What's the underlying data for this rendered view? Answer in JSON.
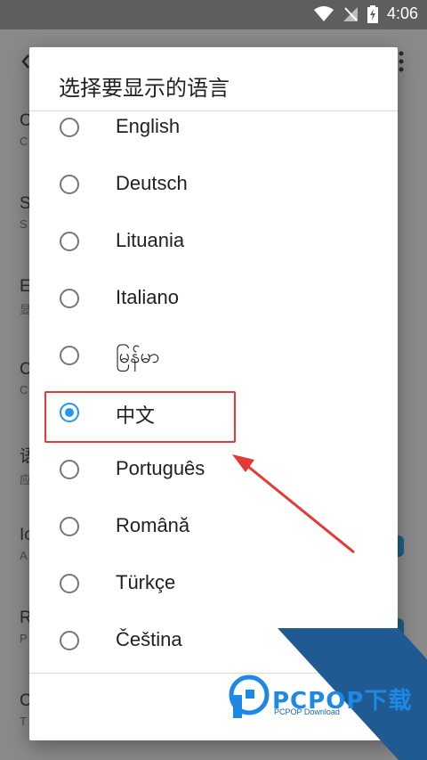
{
  "status": {
    "time": "4:06"
  },
  "background": {
    "rows": [
      {
        "title": "C",
        "subtitle": "C"
      },
      {
        "title": "S",
        "subtitle": "S"
      },
      {
        "title": "E",
        "subtitle": "显"
      },
      {
        "title": "C",
        "subtitle": "C"
      },
      {
        "title": "语",
        "subtitle": "应"
      },
      {
        "title": "Ic",
        "subtitle": "A"
      },
      {
        "title": "R",
        "subtitle": "P"
      },
      {
        "title": "C",
        "subtitle": "T"
      }
    ]
  },
  "dialog": {
    "title": "选择要显示的语言",
    "options": [
      {
        "label": "English",
        "checked": false
      },
      {
        "label": "Deutsch",
        "checked": false
      },
      {
        "label": "Lituania",
        "checked": false
      },
      {
        "label": "Italiano",
        "checked": false
      },
      {
        "label": "မြန်မာ",
        "checked": false
      },
      {
        "label": "中文",
        "checked": true
      },
      {
        "label": "Português",
        "checked": false
      },
      {
        "label": "Română",
        "checked": false
      },
      {
        "label": "Türkçe",
        "checked": false
      },
      {
        "label": "Čeština",
        "checked": false
      }
    ]
  },
  "watermark": {
    "text": "PCPOP下载",
    "subtext": "PCPOP Download"
  },
  "colors": {
    "accent": "#2196f3",
    "annotation": "#e53935",
    "watermark": "#1565c0"
  }
}
